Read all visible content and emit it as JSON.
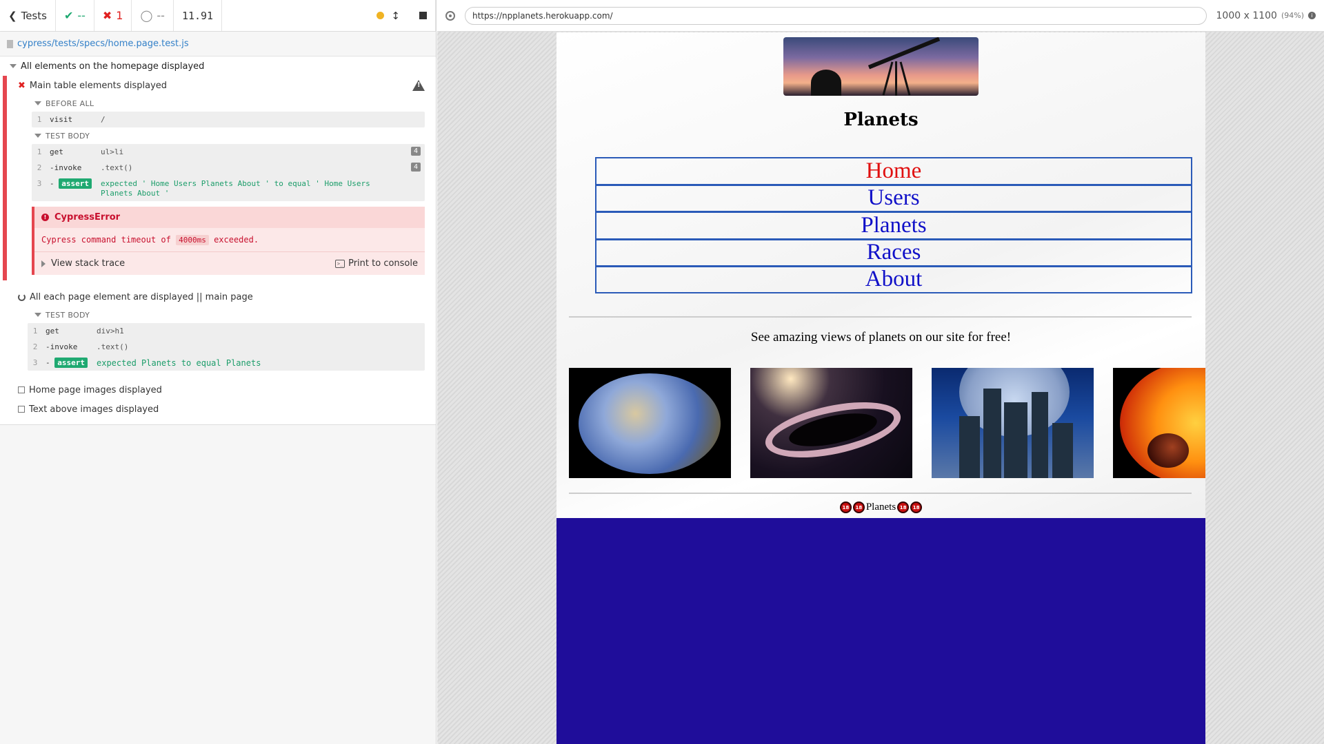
{
  "runner": {
    "back_label": "Tests",
    "passed": "--",
    "failed": "1",
    "pending": "--",
    "duration": "11.91",
    "spec_path": "cypress/tests/specs/home.page.test.js",
    "suite_title": "All elements on the homepage displayed",
    "failed_test": {
      "title": "Main table elements displayed",
      "before_all_label": "BEFORE ALL",
      "before_all_cmds": [
        {
          "num": "1",
          "name": "visit",
          "msg": "/"
        }
      ],
      "test_body_label": "TEST BODY",
      "body_cmds": [
        {
          "num": "1",
          "name": "get",
          "msg": "ul>li",
          "badge": "4"
        },
        {
          "num": "2",
          "name": "-invoke",
          "msg": ".text()",
          "badge": "4"
        },
        {
          "num": "3",
          "prefix": "-",
          "name": "assert",
          "msg": "expected ' Home Users Planets About ' to equal ' Home Users Planets About '"
        }
      ],
      "error": {
        "name": "CypressError",
        "msg_pre": "Cypress command timeout of",
        "msg_code": "4000ms",
        "msg_post": "exceeded.",
        "stack_label": "View stack trace",
        "print_label": "Print to console"
      }
    },
    "running_test": {
      "title": "All each page element are displayed || main page",
      "test_body_label": "TEST BODY",
      "body_cmds": [
        {
          "num": "1",
          "name": "get",
          "msg": "div>h1"
        },
        {
          "num": "2",
          "name": "-invoke",
          "msg": ".text()"
        },
        {
          "num": "3",
          "prefix": "-",
          "name": "assert",
          "msg": "expected Planets to equal Planets"
        }
      ]
    },
    "pending_tests": [
      {
        "title": "Home page images displayed"
      },
      {
        "title": "Text above images displayed"
      }
    ]
  },
  "aut": {
    "url": "https://npplanets.herokuapp.com/",
    "viewport": "1000 x 1100",
    "zoom": "(94%)",
    "page": {
      "heading": "Planets",
      "nav": [
        "Home",
        "Users",
        "Planets",
        "Races",
        "About"
      ],
      "active_nav": "Home",
      "tagline": "See amazing views of planets on our site for free!",
      "footer_text": "Planets",
      "footer_badge": "18"
    }
  },
  "colors": {
    "pass": "#1fa971",
    "fail": "#e02020",
    "nav_link": "#1010c8",
    "nav_active": "#e01010",
    "page_footer_bg": "#1f0d9a"
  }
}
